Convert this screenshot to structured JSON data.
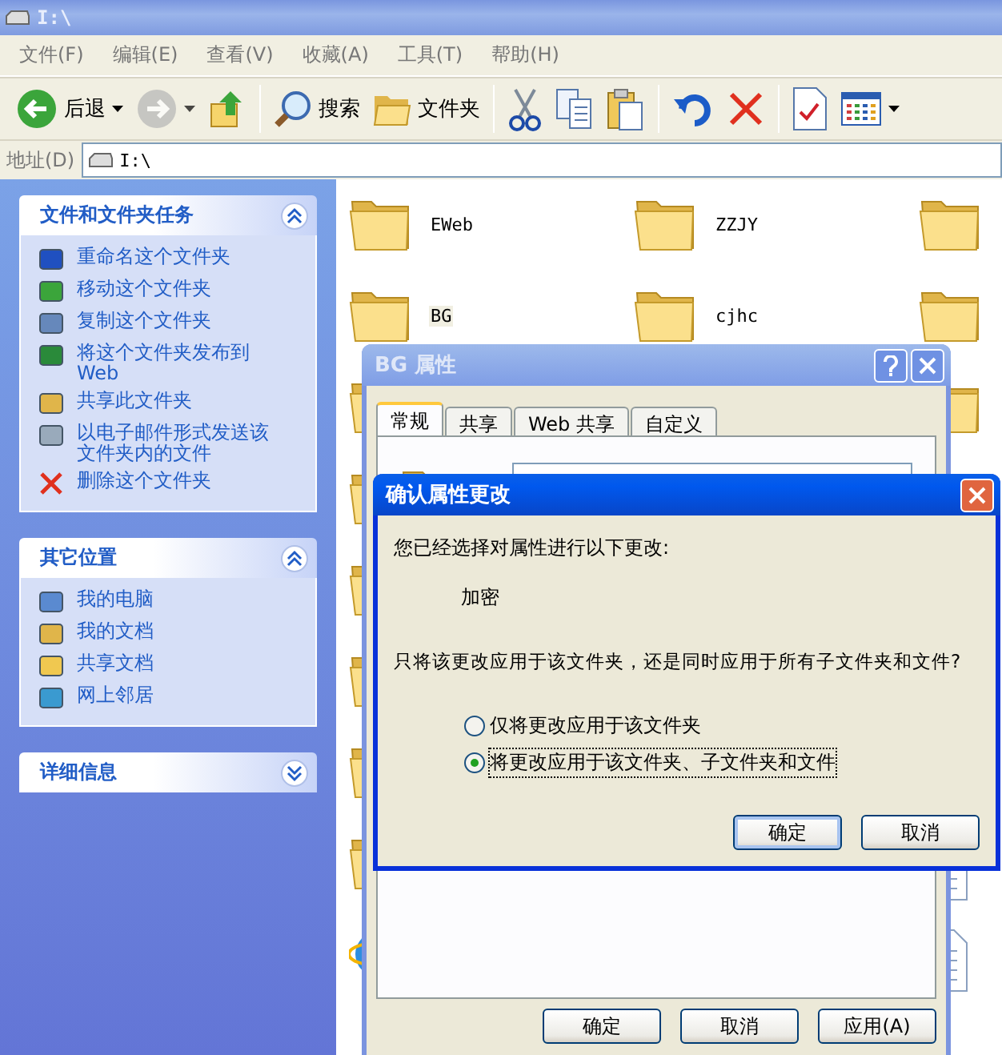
{
  "window": {
    "title": "I:\\"
  },
  "menu": [
    "文件(F)",
    "编辑(E)",
    "查看(V)",
    "收藏(A)",
    "工具(T)",
    "帮助(H)"
  ],
  "toolbar": [
    {
      "kind": "back",
      "label": "后退",
      "disabled": false,
      "dropdown": true
    },
    {
      "kind": "forward",
      "disabled": true,
      "dropdown": true
    },
    {
      "kind": "up",
      "disabled": false
    },
    {
      "kind": "separator"
    },
    {
      "kind": "search",
      "label": "搜索",
      "disabled": false
    },
    {
      "kind": "folders",
      "label": "文件夹",
      "disabled": false
    },
    {
      "kind": "separator"
    },
    {
      "kind": "cut",
      "disabled": false
    },
    {
      "kind": "copy",
      "disabled": false
    },
    {
      "kind": "paste",
      "disabled": false
    },
    {
      "kind": "separator"
    },
    {
      "kind": "undo",
      "disabled": false
    },
    {
      "kind": "delete",
      "disabled": false
    },
    {
      "kind": "separator"
    },
    {
      "kind": "properties",
      "disabled": false
    },
    {
      "kind": "views",
      "disabled": false,
      "dropdown": true
    }
  ],
  "address": {
    "label": "地址(D)",
    "value": "I:\\"
  },
  "sidebar": [
    {
      "title": "文件和文件夹任务",
      "expanded": true,
      "items": [
        "重命名这个文件夹",
        "移动这个文件夹",
        "复制这个文件夹",
        "将这个文件夹发布到 Web",
        "共享此文件夹",
        "以电子邮件形式发送该文件夹内的文件",
        "删除这个文件夹"
      ]
    },
    {
      "title": "其它位置",
      "expanded": true,
      "items": [
        "我的电脑",
        "我的文档",
        "共享文档",
        "网上邻居"
      ]
    },
    {
      "title": "详细信息",
      "expanded": false
    }
  ],
  "content": {
    "columns": [
      {
        "items": [
          {
            "kind": "folder",
            "name": "EWeb"
          },
          {
            "kind": "folder",
            "name": "BG",
            "selected": true
          },
          {
            "kind": "folder"
          },
          {
            "kind": "folder"
          },
          {
            "kind": "folder"
          },
          {
            "kind": "folder"
          },
          {
            "kind": "folder"
          },
          {
            "kind": "folder"
          },
          {
            "kind": "web"
          }
        ]
      },
      {
        "items": [
          {
            "kind": "folder",
            "name": "ZZJY"
          },
          {
            "kind": "folder",
            "name": "cjhc",
            "selected": false
          }
        ]
      },
      {
        "items": [
          {
            "kind": "folder"
          },
          {
            "kind": "folder"
          },
          {
            "kind": "folder"
          },
          {
            "kind": "document"
          },
          {
            "kind": "document"
          }
        ]
      }
    ]
  },
  "properties_dialog": {
    "title": "BG 属性",
    "tabs": [
      {
        "label": "常规",
        "selected": true
      },
      {
        "label": "共享",
        "selected": false
      },
      {
        "label": "Web 共享",
        "selected": false
      },
      {
        "label": "自定义",
        "selected": false
      }
    ],
    "buttons": [
      {
        "label": "确定",
        "default": false
      },
      {
        "label": "取消",
        "default": false
      },
      {
        "label": "应用(A)",
        "default": false
      }
    ]
  },
  "confirm_dialog": {
    "title": "确认属性更改",
    "message": "您已经选择对属性进行以下更改:",
    "change": "加密",
    "question": "只将该更改应用于该文件夹，还是同时应用于所有子文件夹和文件?",
    "options": [
      {
        "label": "仅将更改应用于该文件夹",
        "selected": false
      },
      {
        "label": "将更改应用于该文件夹、子文件夹和文件",
        "selected": true
      }
    ],
    "buttons": [
      {
        "label": "确定",
        "default": true
      },
      {
        "label": "取消",
        "default": false
      }
    ]
  }
}
